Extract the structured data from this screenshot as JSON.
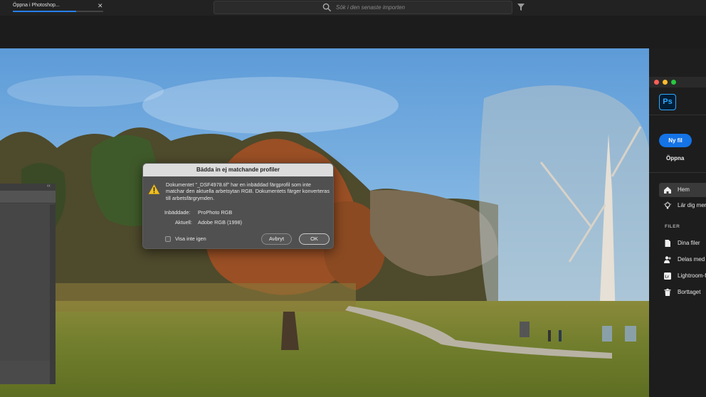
{
  "tab": {
    "label": "Öppna i Photoshop...",
    "progress_percent": 70
  },
  "search": {
    "placeholder": "Sök i den senaste importen"
  },
  "dialog": {
    "title": "Bädda in ej matchande profiler",
    "message": "Dokumentet \"_DSF4978.tif\" har en inbäddad färgprofil som inte matchar den aktuella arbetsytan RGB.  Dokumentets färger konverteras till arbetsfärgrymden.",
    "embedded_label": "Inbäddade:",
    "embedded_value": "ProPhoto RGB",
    "current_label": "Aktuell:",
    "current_value": "Adobe RGB (1998)",
    "dont_show_label": "Visa inte igen",
    "cancel_label": "Avbryt",
    "ok_label": "OK"
  },
  "ps_home": {
    "logo_text": "Ps",
    "new_file_label": "Ny fil",
    "open_label": "Öppna",
    "nav": [
      {
        "label": "Hem",
        "icon": "home-icon",
        "selected": true
      },
      {
        "label": "Lär dig mer",
        "icon": "lightbulb-icon",
        "selected": false
      }
    ],
    "files_section": "FILER",
    "files": [
      {
        "label": "Dina filer",
        "icon": "document-icon"
      },
      {
        "label": "Delas med dig",
        "icon": "people-icon"
      },
      {
        "label": "Lightroom-foton",
        "icon": "lightroom-icon"
      },
      {
        "label": "Borttaget",
        "icon": "trash-icon"
      }
    ]
  },
  "colors": {
    "accent": "#1473e6",
    "ps_blue": "#31a8ff",
    "progress": "#2680eb"
  }
}
